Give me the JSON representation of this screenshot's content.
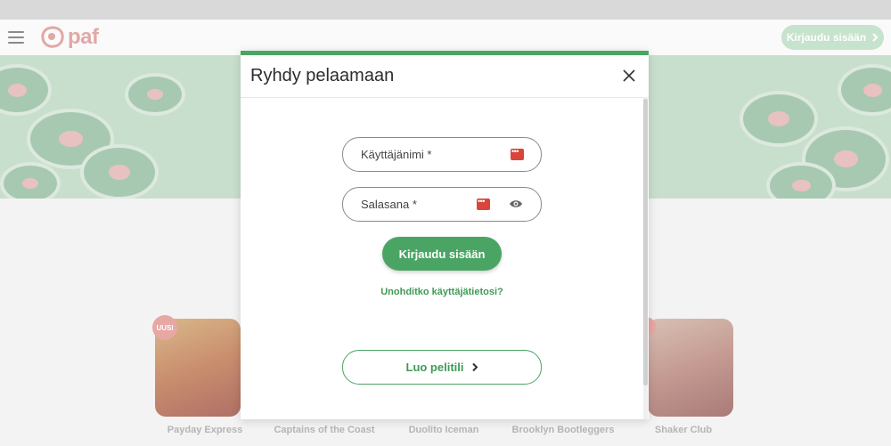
{
  "header": {
    "menu_icon": "hamburger-menu-icon",
    "logo_text": "paf",
    "login_button_label": "Kirjaudu sisään",
    "login_button_icon": "chevron-right-icon"
  },
  "games": [
    {
      "title": "Payday Express",
      "badge": "UUSI"
    },
    {
      "title": "Captains of the Coast"
    },
    {
      "title": "Duolito Iceman"
    },
    {
      "title": "Brooklyn Bootleggers"
    },
    {
      "title": "Shaker Club"
    }
  ],
  "modal": {
    "title": "Ryhdy pelaamaan",
    "close_icon": "close-icon",
    "username_label": "Käyttäjänimi *",
    "password_label": "Salasana *",
    "password_manager_icon": "password-manager-icon",
    "show_password_icon": "eye-icon",
    "login_button": "Kirjaudu sisään",
    "forgot_link": "Unohditko käyttäjätietosi?",
    "create_account_button": "Luo pelitili",
    "create_account_icon": "chevron-right-icon"
  },
  "colors": {
    "brand_green": "#4aa564",
    "password_icon_red": "#d9453a"
  }
}
